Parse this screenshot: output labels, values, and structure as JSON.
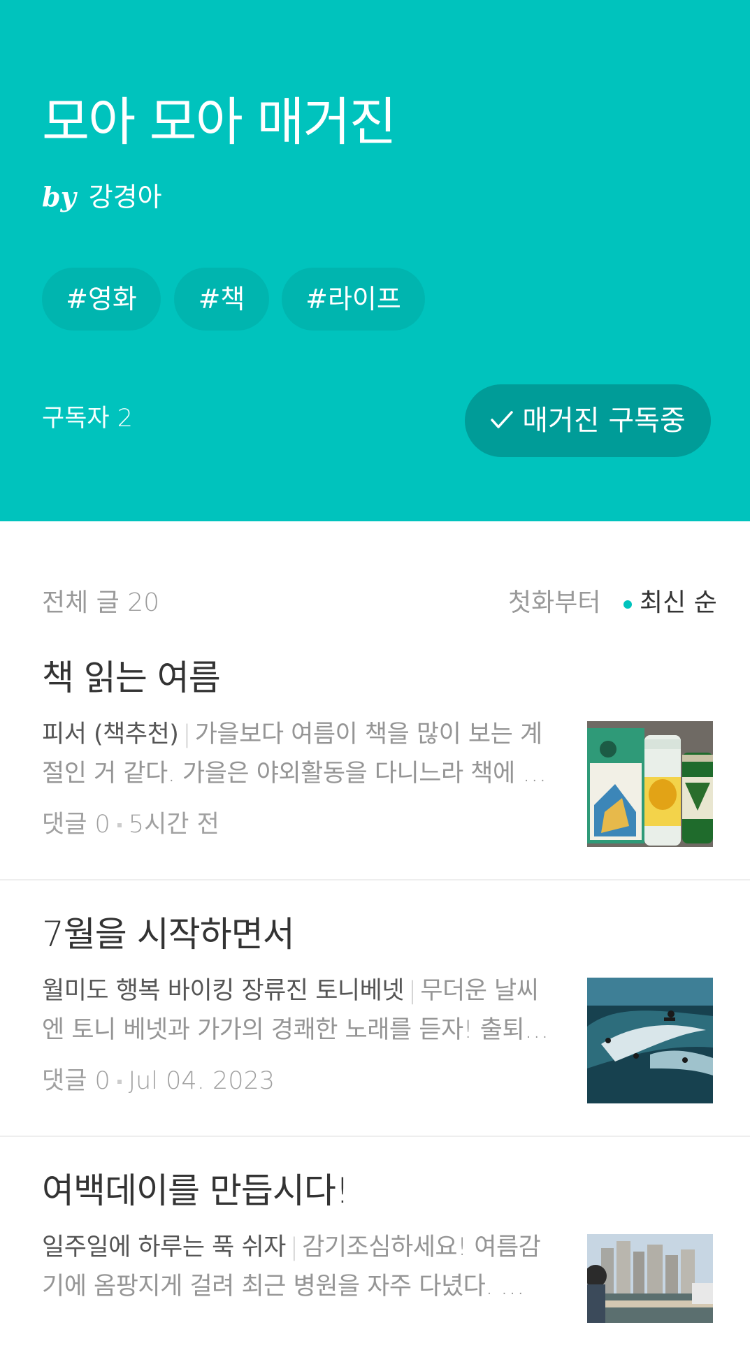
{
  "magazine": {
    "title": "모아 모아 매거진",
    "by_label": "by",
    "author": "강경아",
    "tags": [
      "#영화",
      "#책",
      "#라이프"
    ],
    "subscribers_label": "구독자 2",
    "subscribe_button_label": "매거진 구독중",
    "accent_color": "#00c3bd"
  },
  "list": {
    "total_label": "전체 글 20",
    "sort_first_label": "첫화부터",
    "sort_latest_label": "최신 순"
  },
  "posts": [
    {
      "title": "책 읽는 여름",
      "subtitle": "피서 (책추천)",
      "excerpt": "가을보다 여름이 책을 많이 보는 계절인 거 같다. 가을은 야외활동을 다니느라 책에 …",
      "comments": "댓글 0",
      "date": "5시간 전",
      "thumb_icon": "book-and-beer-photo"
    },
    {
      "title": "7월을 시작하면서",
      "subtitle": "월미도 행복 바이킹 장류진 토니베넷",
      "excerpt": "무더운 날씨엔 토니 베넷과 가가의 경쾌한 노래를 듣자! 출퇴…",
      "comments": "댓글 0",
      "date": "Jul 04. 2023",
      "thumb_icon": "surfers-on-wave-photo"
    },
    {
      "title": "여백데이를 만듭시다!",
      "subtitle": "일주일에 하루는 푹 쉬자",
      "excerpt": "감기조심하세요! 여름감기에 옴팡지게 걸려 최근 병원을 자주 다녔다. …",
      "comments": "",
      "date": "",
      "thumb_icon": "waterfront-city-photo"
    }
  ]
}
